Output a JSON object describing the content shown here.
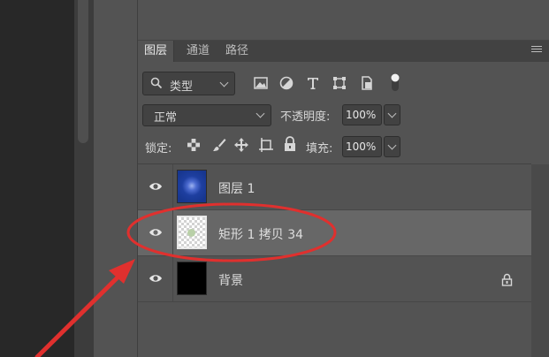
{
  "tabs": [
    {
      "label": "图层"
    },
    {
      "label": "通道"
    },
    {
      "label": "路径"
    }
  ],
  "filter": {
    "label": "类型"
  },
  "blend": {
    "mode": "正常",
    "opacity_label": "不透明度:",
    "opacity_value": "100%"
  },
  "lock": {
    "label": "锁定:"
  },
  "fill": {
    "label": "填充:",
    "value": "100%"
  },
  "layers": [
    {
      "name": "图层 1",
      "thumb_color": "#1e3fa0"
    },
    {
      "name": "矩形 1 拷贝 34",
      "thumb_color": "transparent"
    },
    {
      "name": "背景",
      "thumb_color": "#000000"
    }
  ],
  "colors": {
    "panel_bg": "#535353",
    "selected_row": "#676767",
    "annotation_red": "#e0302e"
  },
  "icons": [
    "search-icon",
    "image-filter-icon",
    "adjustment-filter-icon",
    "type-filter-icon",
    "shape-filter-icon",
    "smart-object-filter-icon",
    "filter-toggle-icon",
    "lock-transparent-icon",
    "lock-paint-icon",
    "lock-position-icon",
    "lock-artboard-icon",
    "lock-all-icon",
    "eye-icon",
    "lock-icon"
  ]
}
